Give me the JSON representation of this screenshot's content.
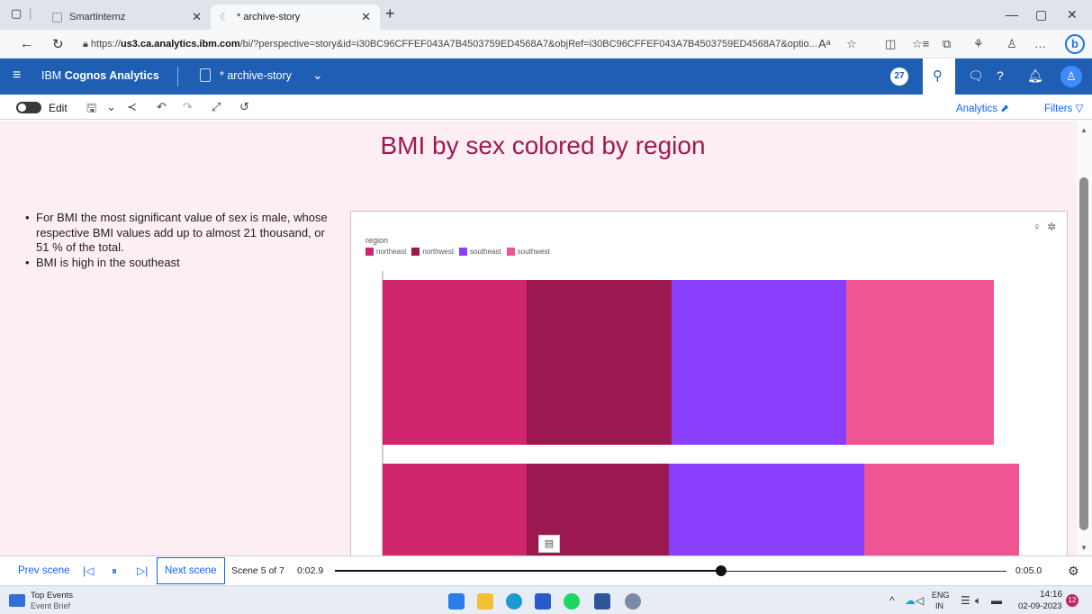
{
  "browser": {
    "tabs": [
      {
        "title": "Smartinternz",
        "active": false
      },
      {
        "title": "* archive-story",
        "active": true
      }
    ],
    "url_prefix": "https://",
    "url_host": "us3.ca.analytics.ibm.com",
    "url_rest": "/bi/?perspective=story&id=i30BC96CFFEF043A7B4503759ED4568A7&objRef=i30BC96CFFEF043A7B4503759ED4568A7&optio..."
  },
  "app": {
    "brand_plain": "IBM ",
    "brand_bold": "Cognos Analytics",
    "doc_title": "* archive-story",
    "notification_count": "27"
  },
  "toolbar": {
    "edit_label": "Edit",
    "analytics_label": "Analytics",
    "filters_label": "Filters"
  },
  "scene": {
    "title": "BMI by sex colored by region",
    "insights": [
      "For BMI the most significant value of sex is male, whose respective BMI values add up to almost 21 thousand, or 51 % of the total.",
      "BMI is high in the southeast"
    ]
  },
  "chart_data": {
    "type": "bar",
    "orientation": "horizontal-stacked",
    "legend_title": "region",
    "legend_placement": "top-left",
    "series": [
      {
        "name": "northeast",
        "color": "#d0266e",
        "values": [
          160,
          160
        ]
      },
      {
        "name": "northwest",
        "color": "#9c1850",
        "values": [
          161,
          158
        ]
      },
      {
        "name": "southeast",
        "color": "#8a3ffc",
        "values": [
          194,
          217
        ]
      },
      {
        "name": "southwest",
        "color": "#ef5592",
        "values": [
          164,
          172
        ]
      }
    ]
  },
  "playback": {
    "prev_label": "Prev scene",
    "next_label": "Next scene",
    "scene_count": "Scene 5 of 7",
    "current_time": "0:02.9",
    "total_time": "0:05.0",
    "progress": 0.575
  },
  "taskbar": {
    "event_title": "Top Events",
    "event_subtitle": "Event Brief",
    "lang_top": "ENG",
    "lang_bottom": "IN",
    "time": "14:16",
    "date": "02-09-2023",
    "badge": "12"
  }
}
